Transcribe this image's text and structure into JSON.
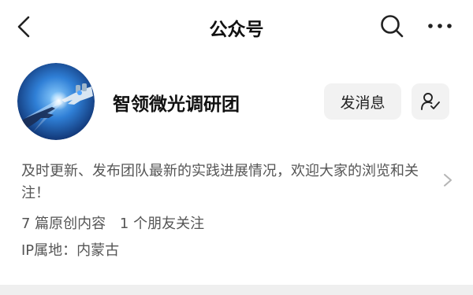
{
  "header": {
    "title": "公众号",
    "icons": [
      "back-icon",
      "search-icon",
      "more-icon"
    ]
  },
  "account": {
    "name": "智领微光调研团",
    "avatar_icon": "robot-hand-avatar",
    "description": "及时更新、发布团队最新的实践进展情况，欢迎大家的浏览和关注！",
    "stats": {
      "original": "7 篇原创内容",
      "friends": "1 个朋友关注"
    },
    "ip": "IP属地：内蒙古"
  },
  "actions": {
    "message_label": "发消息",
    "follow_icon": "follow-user-icon"
  },
  "colors": {
    "background": "#ffffff",
    "button_bg": "#f2f2f2",
    "text_primary": "#111111",
    "text_secondary": "#555555",
    "divider": "#efefef"
  }
}
